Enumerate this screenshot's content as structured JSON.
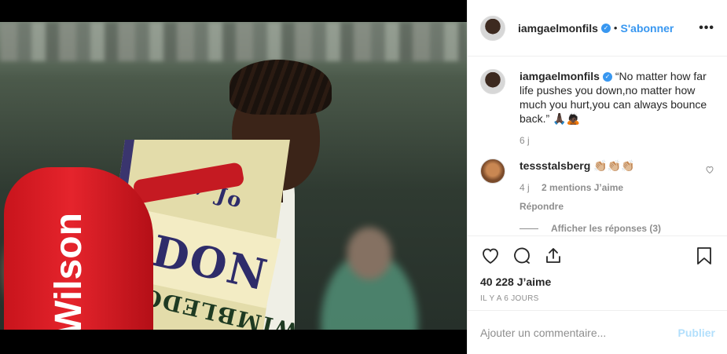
{
  "post_image": {
    "towel_text_main": "EDON",
    "towel_text_lower": "WIMBLEDON",
    "towel_text_side": "7 Jo",
    "bag_brand": "Wilson"
  },
  "header": {
    "username": "iamgaelmonfils",
    "verified": true,
    "separator": "•",
    "follow_label": "S'abonner",
    "more_label": "•••"
  },
  "caption": {
    "username": "iamgaelmonfils",
    "text": "“No matter how far life pushes you down,no matter how much you hurt,you can always bounce back.” 🙏🏿🙇🏿",
    "time": "6 j"
  },
  "comment": {
    "username": "tessstalsberg",
    "text": "👏🏼👏🏼👏🏼",
    "time": "4 j",
    "likes": "2 mentions J’aime",
    "reply_label": "Répondre",
    "show_replies": "Afficher les réponses (3)"
  },
  "actions": {
    "icons": [
      "heart-icon",
      "comment-icon",
      "share-icon",
      "bookmark-icon"
    ]
  },
  "likes": "40 228 J’aime",
  "date": "IL Y A 6 JOURS",
  "add_comment": {
    "placeholder": "Ajouter un commentaire...",
    "post_label": "Publier"
  },
  "colors": {
    "accent": "#3897f0",
    "muted": "#8e8e8e",
    "post_disabled": "#b2dffc"
  }
}
